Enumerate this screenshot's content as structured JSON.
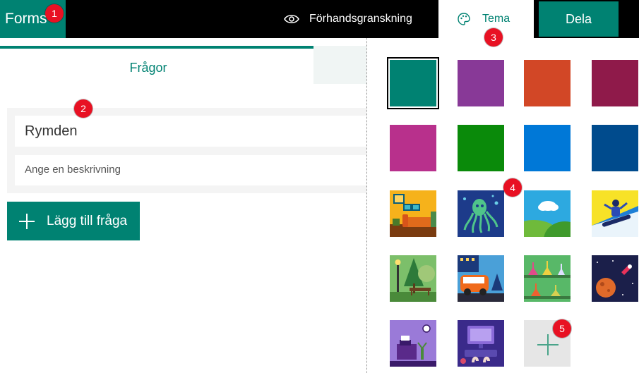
{
  "header": {
    "brand": "Forms",
    "preview_label": "Förhandsgranskning",
    "theme_label": "Tema",
    "share_label": "Dela"
  },
  "editor": {
    "tab_questions": "Frågor",
    "form_title": "Rymden",
    "description_placeholder": "Ange en beskrivning",
    "add_question_label": "Lägg till fråga"
  },
  "theme_panel": {
    "colors": [
      "#008272",
      "#883997",
      "#d24726",
      "#8f1a4a",
      "#b8308c",
      "#0a8a0a",
      "#0078d7",
      "#004b8d"
    ],
    "images": [
      "living-room",
      "octopus",
      "hills-cloud",
      "snowboarder",
      "park",
      "van",
      "lab-flasks",
      "space-planet",
      "office-desk",
      "computer-hands"
    ],
    "add_theme_icon": "plus-icon",
    "selected": "#008272"
  },
  "annotations": [
    "1",
    "2",
    "3",
    "4",
    "5"
  ]
}
